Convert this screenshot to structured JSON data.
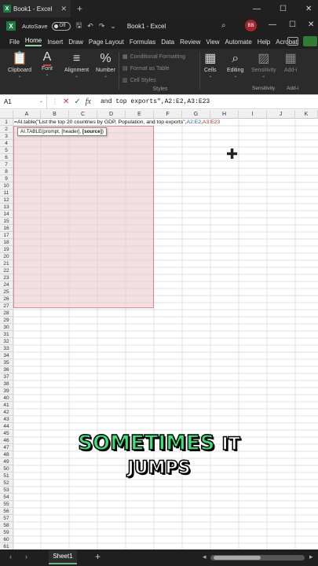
{
  "window": {
    "tab_title": "Book1 - Excel",
    "doc_title": "Book1 - Excel",
    "autosave_label": "AutoSave",
    "autosave_state": "Off",
    "user_initials": "BB"
  },
  "ribbon_tabs": [
    "File",
    "Home",
    "Insert",
    "Draw",
    "Page Layout",
    "Formulas",
    "Data",
    "Review",
    "View",
    "Automate",
    "Help",
    "Acrobat"
  ],
  "ribbon": {
    "clipboard": "Clipboard",
    "font": "Font",
    "alignment": "Alignment",
    "number": "Number",
    "conditional_formatting": "Conditional Formatting",
    "format_as_table": "Format as Table",
    "cell_styles": "Cell Styles",
    "styles_group": "Styles",
    "cells": "Cells",
    "editing": "Editing",
    "sensitivity": "Sensitivity",
    "sensitivity_group": "Sensitivity",
    "addins": "Add-i",
    "addins_group": "Add-i"
  },
  "formula_bar": {
    "name_box": "A1",
    "fx": "fx",
    "content": "and top exports\",A2:E2,A3:E23"
  },
  "columns": [
    "A",
    "B",
    "C",
    "D",
    "E",
    "F",
    "G",
    "H",
    "I",
    "J",
    "K"
  ],
  "rows": [
    "1",
    "2",
    "3",
    "4",
    "5",
    "6",
    "7",
    "8",
    "9",
    "10",
    "11",
    "12",
    "13",
    "14",
    "15",
    "16",
    "17",
    "18",
    "19",
    "20",
    "21",
    "22",
    "23",
    "24",
    "25",
    "26",
    "27",
    "28",
    "29",
    "30",
    "31",
    "32",
    "33",
    "34",
    "35",
    "36",
    "37",
    "38",
    "39",
    "40",
    "41",
    "42",
    "43",
    "44",
    "45",
    "46",
    "47",
    "48",
    "49",
    "50",
    "51",
    "52",
    "53",
    "54",
    "55",
    "56",
    "57",
    "58",
    "59",
    "60",
    "61"
  ],
  "cell_formula": {
    "prefix": "=AI.table(\"List the top 20 countries by GDP, Population, and top exports\",",
    "ref1": "A2:E2",
    "sep": ",",
    "ref2": "A3:E23"
  },
  "tooltip": {
    "fn": "AI.TABLE(prompt, [header], ",
    "bold": "[source]",
    "end": ")"
  },
  "caption": {
    "line1_highlight": "SOMETIMES",
    "line1_rest": "IT",
    "line2": "JUMPS"
  },
  "sheet_tabs": [
    "Sheet1"
  ]
}
